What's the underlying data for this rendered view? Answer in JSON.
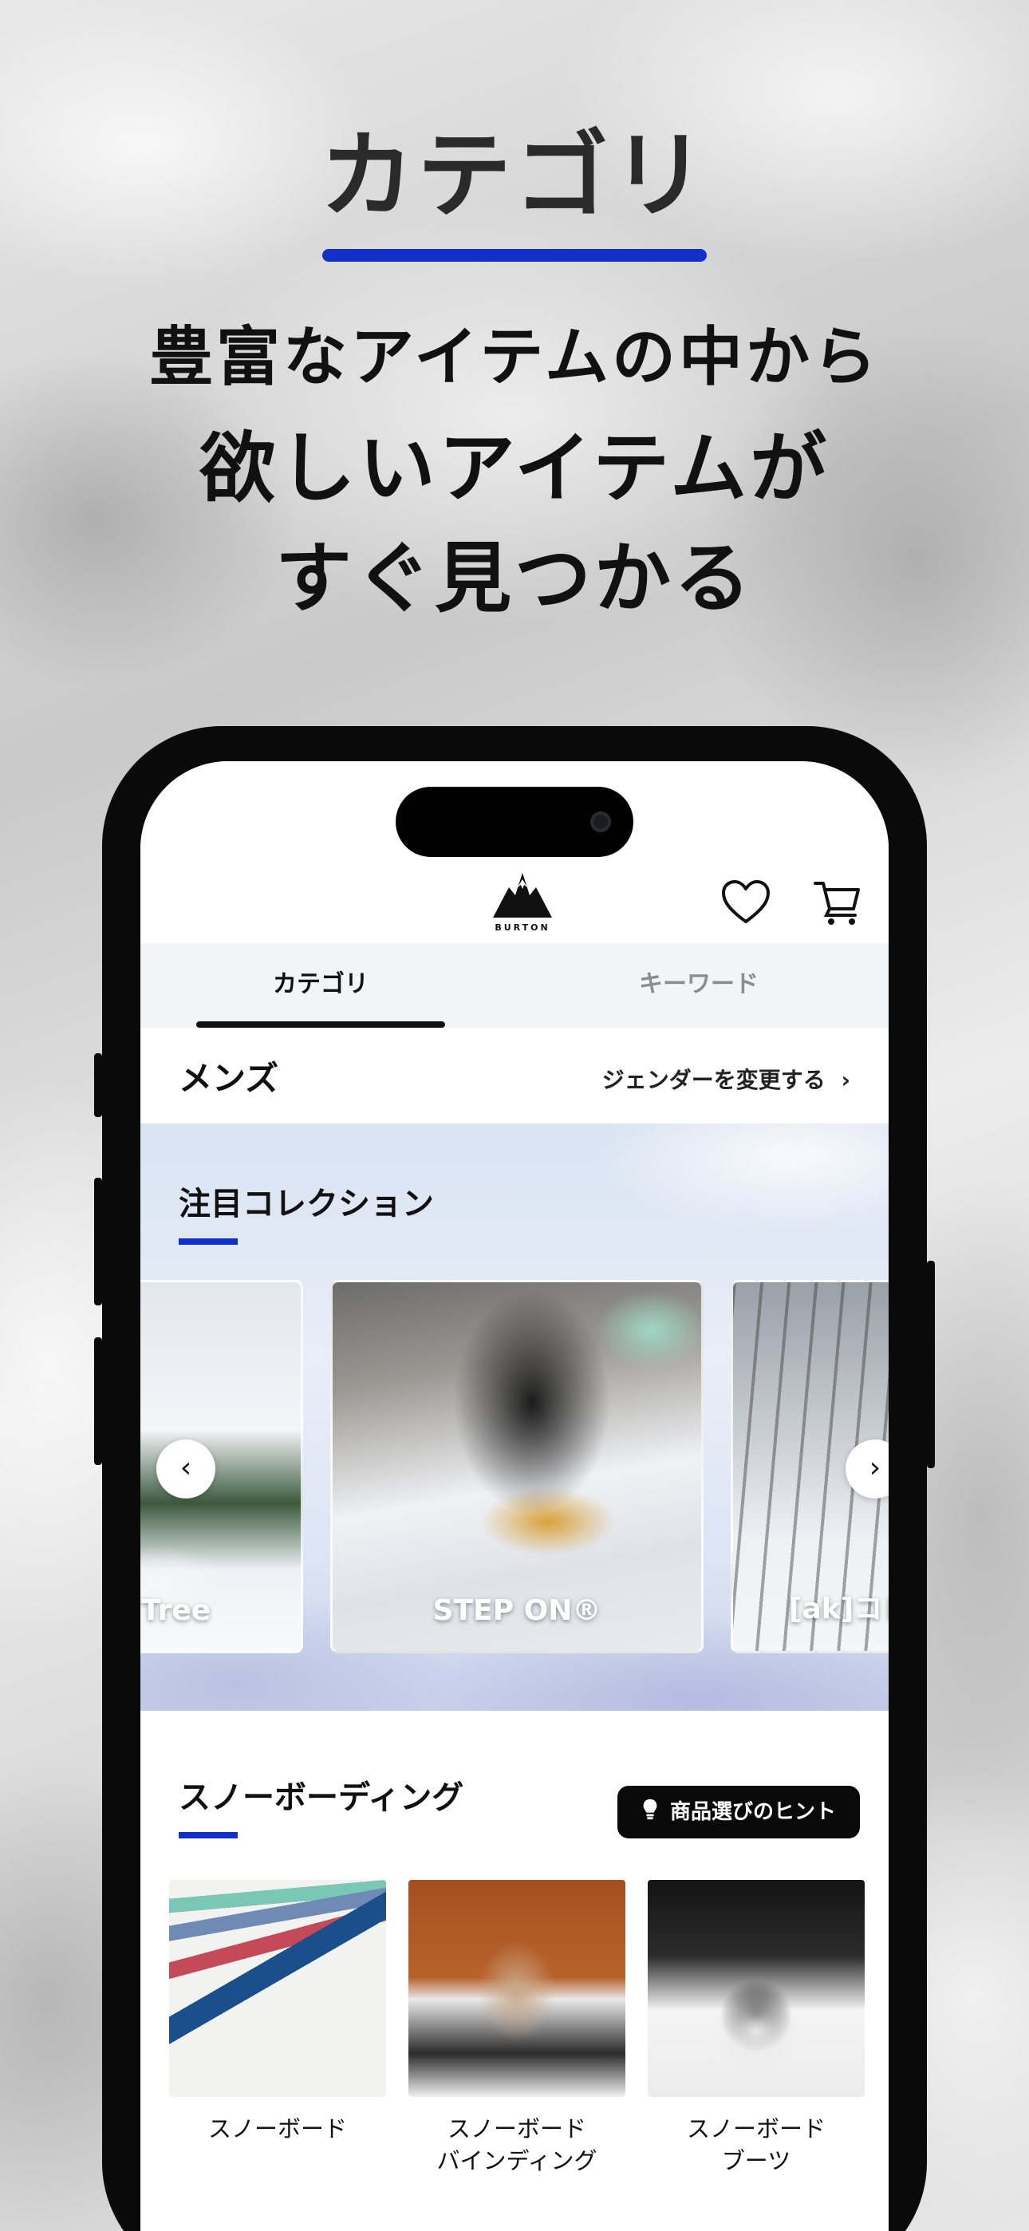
{
  "hero": {
    "title": "カテゴリ",
    "line1": "豊富なアイテムの中から",
    "line2": "欲しいアイテムが",
    "line3": "すぐ見つかる"
  },
  "colors": {
    "accent": "#1230c8",
    "dark": "#0a0a0a"
  },
  "app": {
    "brand": "BURTON",
    "icons": [
      "burton-logo",
      "heart-icon",
      "cart-icon"
    ],
    "tabs": {
      "category": "カテゴリ",
      "keyword": "キーワード",
      "active": "カテゴリ"
    },
    "gender": {
      "current": "メンズ",
      "change_label": "ジェンダーを変更する"
    },
    "featured": {
      "title": "注目コレクション",
      "cards": [
        {
          "label": "Tree"
        },
        {
          "label": "STEP ON®"
        },
        {
          "label": "[ak]コレ"
        }
      ]
    },
    "snowboarding": {
      "title": "スノーボーディング",
      "hint_button": "商品選びのヒント",
      "categories": [
        {
          "line1": "スノーボード",
          "line2": ""
        },
        {
          "line1": "スノーボード",
          "line2": "バインディング"
        },
        {
          "line1": "スノーボード",
          "line2": "ブーツ"
        }
      ]
    }
  }
}
